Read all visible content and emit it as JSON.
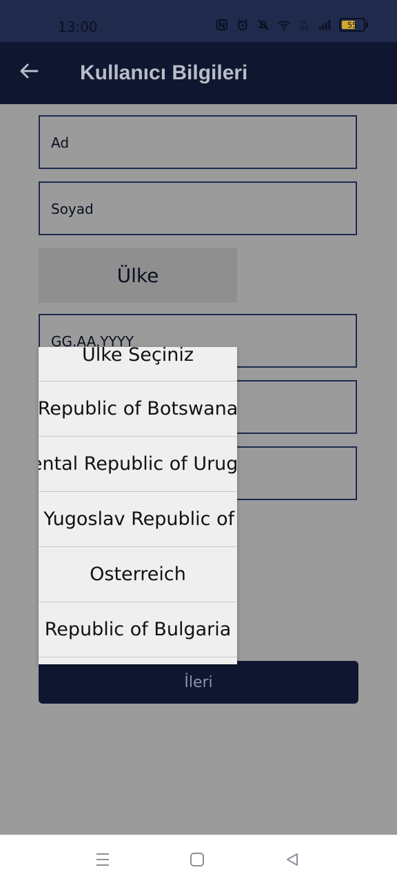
{
  "status": {
    "time": "13:00",
    "battery": "55",
    "icons": [
      "nfc-icon",
      "alarm-icon",
      "mute-icon",
      "wifi-icon",
      "volte-icon",
      "signal-icon",
      "battery-icon"
    ]
  },
  "appbar": {
    "title": "Kullanıcı Bilgileri",
    "back_icon": "arrow-left-icon"
  },
  "form": {
    "first_name_label": "Ad",
    "last_name_label": "Soyad",
    "country_button": "Ülke",
    "birthdate_placeholder": "GG.AA.YYYY",
    "next_button": "İleri"
  },
  "dropdown": {
    "items": [
      "Ülke Seçiniz",
      "Republic of Botswana",
      "Oriental Republic of Uruguay",
      "The former Yugoslav Republic of Macedonia",
      "Osterreich",
      "Republic of Bulgaria"
    ]
  },
  "navbar": {
    "icons": [
      "menu-icon",
      "home-icon",
      "back-icon"
    ]
  },
  "colors": {
    "statusbar": "#1f2a4d",
    "appbar": "#0f1730",
    "scrim": "#9b9b9b",
    "dropdown_bg": "#efefef",
    "button": "#0f1730"
  }
}
